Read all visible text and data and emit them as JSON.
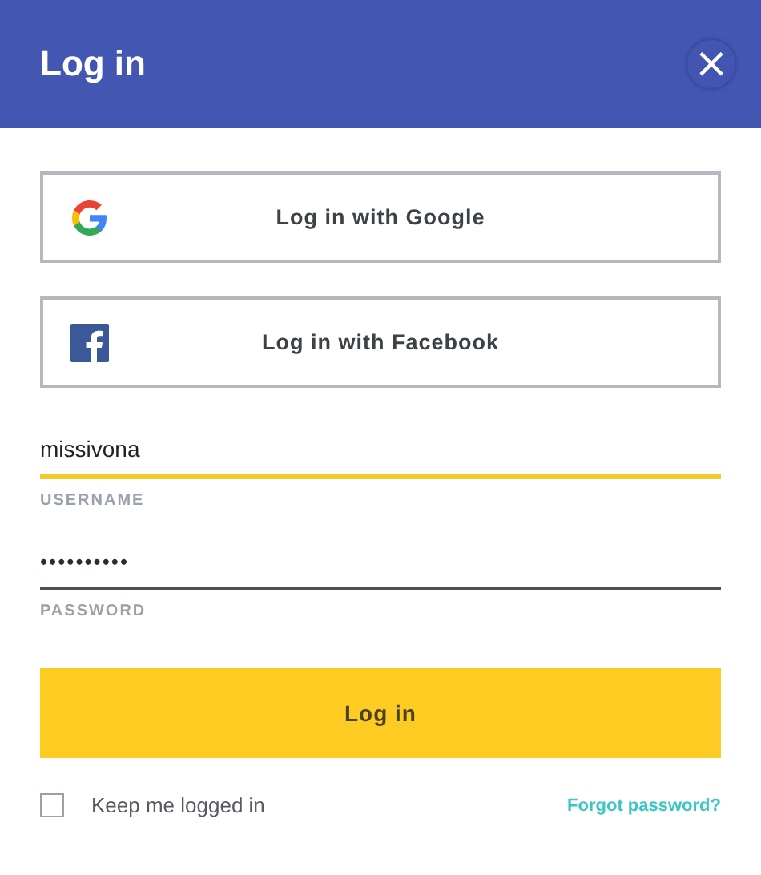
{
  "dialog": {
    "title": "Log in",
    "close_icon": "×"
  },
  "social_buttons": [
    {
      "kind": "google",
      "label": "Log in with Google"
    },
    {
      "kind": "facebook",
      "label": "Log in with Facebook"
    }
  ],
  "fields": [
    {
      "label": "USERNAME",
      "value": "missivona",
      "focused": true
    },
    {
      "label": "PASSWORD",
      "value": "••••••••••",
      "focused": false
    }
  ],
  "submit_button": "Log in",
  "remember": {
    "label": "Keep me logged in",
    "checked": false
  },
  "forgot_link": "Forgot password?"
}
